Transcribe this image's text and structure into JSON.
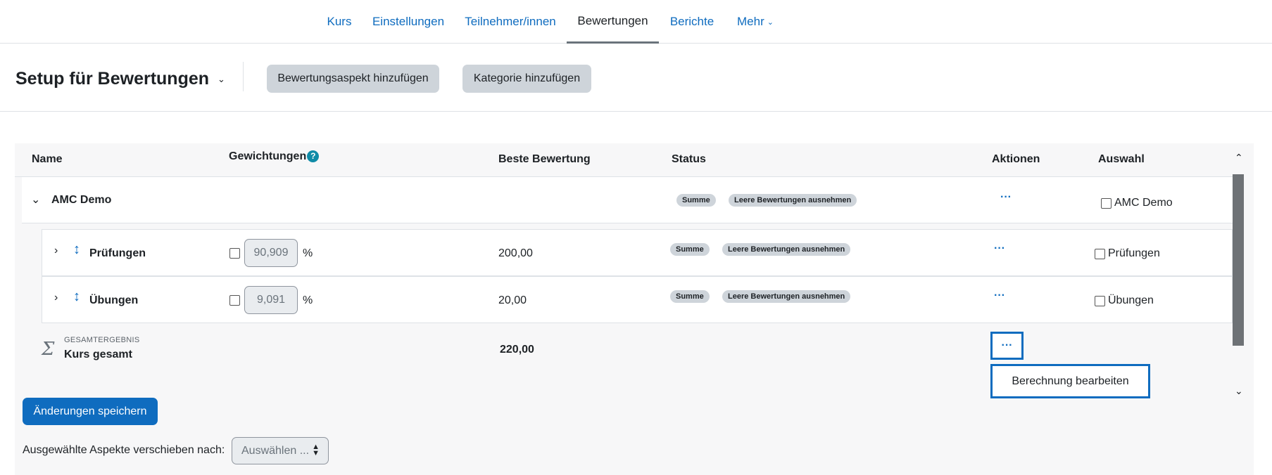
{
  "nav": {
    "tabs": [
      {
        "label": "Kurs"
      },
      {
        "label": "Einstellungen"
      },
      {
        "label": "Teilnehmer/innen"
      },
      {
        "label": "Bewertungen"
      },
      {
        "label": "Berichte"
      },
      {
        "label": "Mehr"
      }
    ],
    "active": "Bewertungen"
  },
  "header": {
    "title": "Setup für Bewertungen",
    "add_item_button": "Bewertungsaspekt hinzufügen",
    "add_category_button": "Kategorie hinzufügen"
  },
  "table": {
    "columns": {
      "name": "Name",
      "weights": "Gewichtungen",
      "weights_help": "?",
      "max_grade": "Beste Bewertung",
      "status": "Status",
      "actions": "Aktionen",
      "select": "Auswahl"
    },
    "category": {
      "name": "AMC Demo",
      "badges": [
        "Summe",
        "Leere Bewertungen ausnehmen"
      ],
      "select_label": "AMC Demo"
    },
    "children": [
      {
        "name": "Prüfungen",
        "weight": "90,909",
        "weight_unit": "%",
        "max_grade": "200,00",
        "badges": [
          "Summe",
          "Leere Bewertungen ausnehmen"
        ],
        "select_label": "Prüfungen"
      },
      {
        "name": "Übungen",
        "weight": "9,091",
        "weight_unit": "%",
        "max_grade": "20,00",
        "badges": [
          "Summe",
          "Leere Bewertungen ausnehmen"
        ],
        "select_label": "Übungen"
      }
    ],
    "total": {
      "caption": "GESAMTERGEBNIS",
      "name": "Kurs gesamt",
      "max_grade": "220,00",
      "menu_item": "Berechnung bearbeiten"
    }
  },
  "footer": {
    "save_button": "Änderungen speichern",
    "move_label": "Ausgewählte Aspekte verschieben nach:",
    "move_select_value": "Auswählen ..."
  },
  "colors": {
    "accent": "#0f6cbf",
    "badge": "#ced4da",
    "help": "#0f8ba7"
  }
}
